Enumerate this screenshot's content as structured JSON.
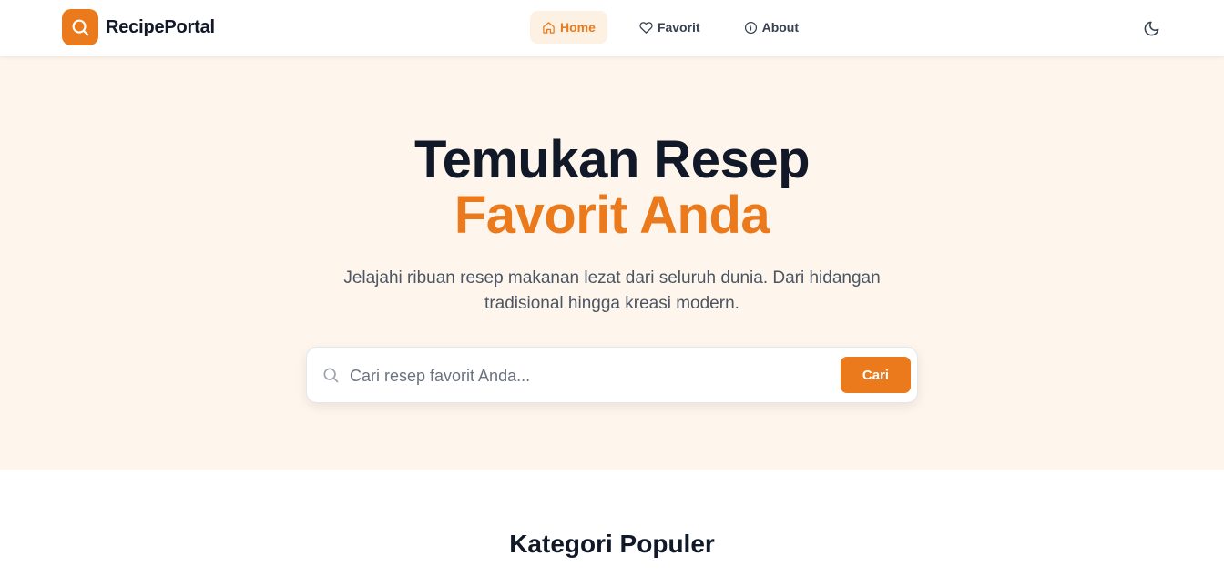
{
  "brand": {
    "name": "RecipePortal",
    "logo_icon": "search-icon",
    "accent_color": "#ea7a1c"
  },
  "nav": {
    "items": [
      {
        "label": "Home",
        "icon": "home-icon",
        "active": true
      },
      {
        "label": "Favorit",
        "icon": "heart-icon",
        "active": false
      },
      {
        "label": "About",
        "icon": "info-icon",
        "active": false
      }
    ],
    "theme_toggle_icon": "moon-icon"
  },
  "hero": {
    "title_line1": "Temukan Resep",
    "title_line2": "Favorit Anda",
    "subtitle": "Jelajahi ribuan resep makanan lezat dari seluruh dunia. Dari hidangan tradisional hingga kreasi modern.",
    "background_color": "#fef5ec"
  },
  "search": {
    "placeholder": "Cari resep favorit Anda...",
    "value": "",
    "button_label": "Cari"
  },
  "categories": {
    "title": "Kategori Populer"
  }
}
